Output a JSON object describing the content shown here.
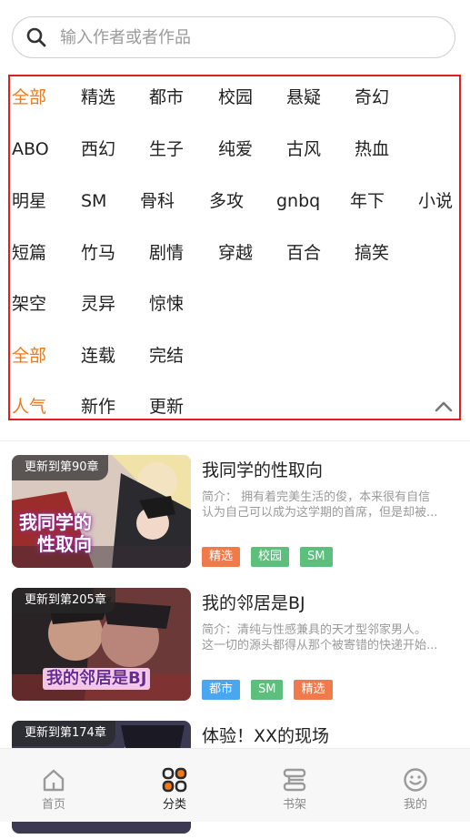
{
  "search": {
    "placeholder": "输入作者或者作品"
  },
  "filter": {
    "genre_rows": [
      [
        "全部",
        "精选",
        "都市",
        "校园",
        "悬疑",
        "奇幻"
      ],
      [
        "ABO",
        "西幻",
        "生子",
        "纯爱",
        "古风",
        "热血"
      ],
      [
        "明星",
        "SM",
        "骨科",
        "多攻",
        "gnbq",
        "年下",
        "小说"
      ],
      [
        "短篇",
        "竹马",
        "剧情",
        "穿越",
        "百合",
        "搞笑"
      ],
      [
        "架空",
        "灵异",
        "惊悚"
      ]
    ],
    "status": [
      "全部",
      "连载",
      "完结"
    ],
    "sort": [
      "人气",
      "新作",
      "更新"
    ],
    "active_genre": "全部",
    "active_status": "全部",
    "active_sort": "人气"
  },
  "books": [
    {
      "update_badge": "更新到第90章",
      "cover_title": [
        "我同学的",
        "性取向"
      ],
      "title": "我同学的性取向",
      "intro": [
        "简介：  拥有着完美生活的俊，本来很有自信",
        "认为自己可以成为这学期的首席，但是却被..."
      ],
      "tags": [
        {
          "label": "精选",
          "color": "#f07a4a"
        },
        {
          "label": "校园",
          "color": "#5cbf7c"
        },
        {
          "label": "SM",
          "color": "#5cbf7c"
        }
      ]
    },
    {
      "update_badge": "更新到第205章",
      "cover_title": [
        "我的邻居是BJ"
      ],
      "title": "我的邻居是BJ",
      "intro": [
        "简介：清纯与性感兼具的天才型邻家男人。",
        "这一切的源头都得从那个被寄错的快递开始..."
      ],
      "tags": [
        {
          "label": "都市",
          "color": "#4aa6ee"
        },
        {
          "label": "SM",
          "color": "#5cbf7c"
        },
        {
          "label": "精选",
          "color": "#f07a4a"
        }
      ]
    },
    {
      "update_badge": "更新到第174章",
      "cover_title": [],
      "title": "体验！XX的现场",
      "intro": [],
      "tags": []
    }
  ],
  "nav": [
    {
      "label": "首页",
      "icon": "home-icon"
    },
    {
      "label": "分类",
      "icon": "category-icon"
    },
    {
      "label": "书架",
      "icon": "bookshelf-icon"
    },
    {
      "label": "我的",
      "icon": "profile-icon"
    }
  ],
  "colors": {
    "accent": "#f07a1a",
    "panel_border": "#e02020"
  }
}
